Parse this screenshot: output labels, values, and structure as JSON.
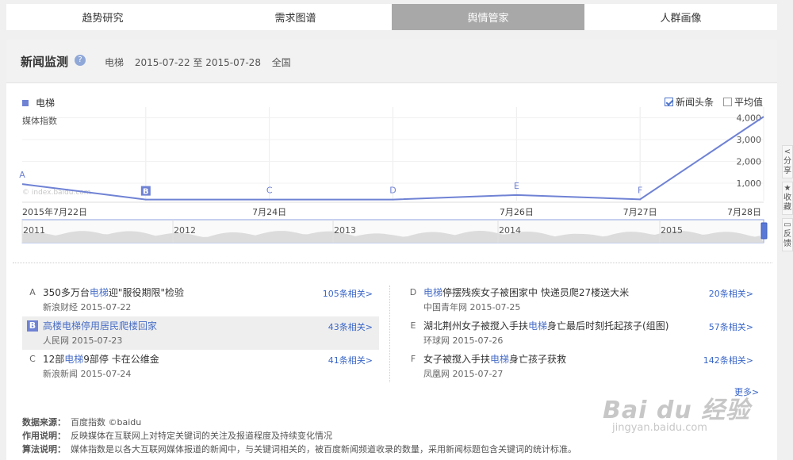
{
  "tabs": [
    {
      "label": "趋势研究",
      "active": false
    },
    {
      "label": "需求图谱",
      "active": false
    },
    {
      "label": "舆情管家",
      "active": true
    },
    {
      "label": "人群画像",
      "active": false
    }
  ],
  "header": {
    "title": "新闻监测",
    "keyword": "电梯",
    "date_range": "2015-07-22 至 2015-07-28",
    "region": "全国"
  },
  "legend": {
    "series_label": "电梯"
  },
  "options": [
    {
      "label": "新闻头条",
      "checked": true
    },
    {
      "label": "平均值",
      "checked": false
    }
  ],
  "chart_data": {
    "type": "line",
    "ylabel": "媒体指数",
    "watermark": "© index.baidu.com",
    "x_ticks": [
      "2015年7月22日",
      "7月24日",
      "7月26日",
      "7月27日",
      "7月28日"
    ],
    "y_ticks": [
      1000,
      2000,
      3000,
      4000
    ],
    "y_tick_labels": [
      "1,000",
      "2,000",
      "3,000",
      "4,000"
    ],
    "ylim": [
      200,
      4200
    ],
    "series": [
      {
        "name": "电梯",
        "color": "#6f82d4",
        "points": [
          {
            "date": "2015-07-22",
            "value": 960
          },
          {
            "date": "2015-07-23",
            "value": 250
          },
          {
            "date": "2015-07-24",
            "value": 250
          },
          {
            "date": "2015-07-25",
            "value": 250
          },
          {
            "date": "2015-07-26",
            "value": 460
          },
          {
            "date": "2015-07-27",
            "value": 260
          },
          {
            "date": "2015-07-28",
            "value": 4050
          }
        ]
      }
    ],
    "markers": [
      {
        "label": "A",
        "date": "2015-07-22",
        "value": 960
      },
      {
        "label": "B",
        "date": "2015-07-23",
        "value": 250,
        "selected": true
      },
      {
        "label": "C",
        "date": "2015-07-24",
        "value": 250
      },
      {
        "label": "D",
        "date": "2015-07-25",
        "value": 250
      },
      {
        "label": "E",
        "date": "2015-07-26",
        "value": 460
      },
      {
        "label": "F",
        "date": "2015-07-27",
        "value": 260
      }
    ],
    "navigator_years": [
      "2011",
      "2012",
      "2013",
      "2014",
      "2015"
    ]
  },
  "news": {
    "left": [
      {
        "letter": "A",
        "title_parts": [
          "350多万台",
          "电梯",
          "迎\"服役期限\"检验"
        ],
        "source": "新浪财经",
        "date": "2015-07-22",
        "related": "105条相关>",
        "highlight": false
      },
      {
        "letter": "B",
        "title_parts": [
          "高楼",
          "电梯",
          "停用居民爬楼回家"
        ],
        "source": "人民网",
        "date": "2015-07-23",
        "related": "43条相关>",
        "highlight": true
      },
      {
        "letter": "C",
        "title_parts": [
          "12部",
          "电梯",
          "9部停 卡在公维金"
        ],
        "source": "新浪新闻",
        "date": "2015-07-24",
        "related": "41条相关>",
        "highlight": false
      }
    ],
    "right": [
      {
        "letter": "D",
        "title_parts": [
          "",
          "电梯",
          "停摆残疾女子被困家中 快递员爬27楼送大米"
        ],
        "source": "中国青年网",
        "date": "2015-07-25",
        "related": "20条相关>",
        "highlight": false
      },
      {
        "letter": "E",
        "title_parts": [
          "湖北荆州女子被搅入手扶",
          "电梯",
          "身亡最后时刻托起孩子(组图)"
        ],
        "source": "环球网",
        "date": "2015-07-26",
        "related": "57条相关>",
        "highlight": false
      },
      {
        "letter": "F",
        "title_parts": [
          "女子被搅入手扶",
          "电梯",
          "身亡孩子获救"
        ],
        "source": "凤凰网",
        "date": "2015-07-27",
        "related": "142条相关>",
        "highlight": false
      }
    ],
    "more": "更多>"
  },
  "notes": [
    {
      "label": "数据来源：",
      "text": "百度指数 ©baidu"
    },
    {
      "label": "作用说明：",
      "text": "反映媒体在互联网上对特定关键词的关注及报道程度及持续变化情况"
    },
    {
      "label": "算法说明：",
      "text": "媒体指数是以各大互联网媒体报道的新闻中，与关键词相关的，被百度新闻频道收录的数量，采用新闻标题包含关键词的统计标准。"
    }
  ],
  "side_tools": [
    {
      "label": "分享",
      "icon": "share-icon"
    },
    {
      "label": "收藏",
      "icon": "star-icon"
    },
    {
      "label": "反馈",
      "icon": "feedback-icon"
    }
  ],
  "watermark": {
    "top": "Bai du 经验",
    "bottom": "jingyan.baidu.com"
  }
}
